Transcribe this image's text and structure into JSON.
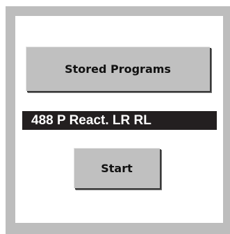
{
  "colors": {
    "frame": "#bdbdbd",
    "background": "#ffffff",
    "button_face": "#c0c0c0",
    "program_bar": "#231f20",
    "program_text": "#ffffff"
  },
  "buttons": {
    "stored_programs_label": "Stored Programs",
    "start_label": "Start"
  },
  "program": {
    "name": "488 P React. LR RL"
  }
}
